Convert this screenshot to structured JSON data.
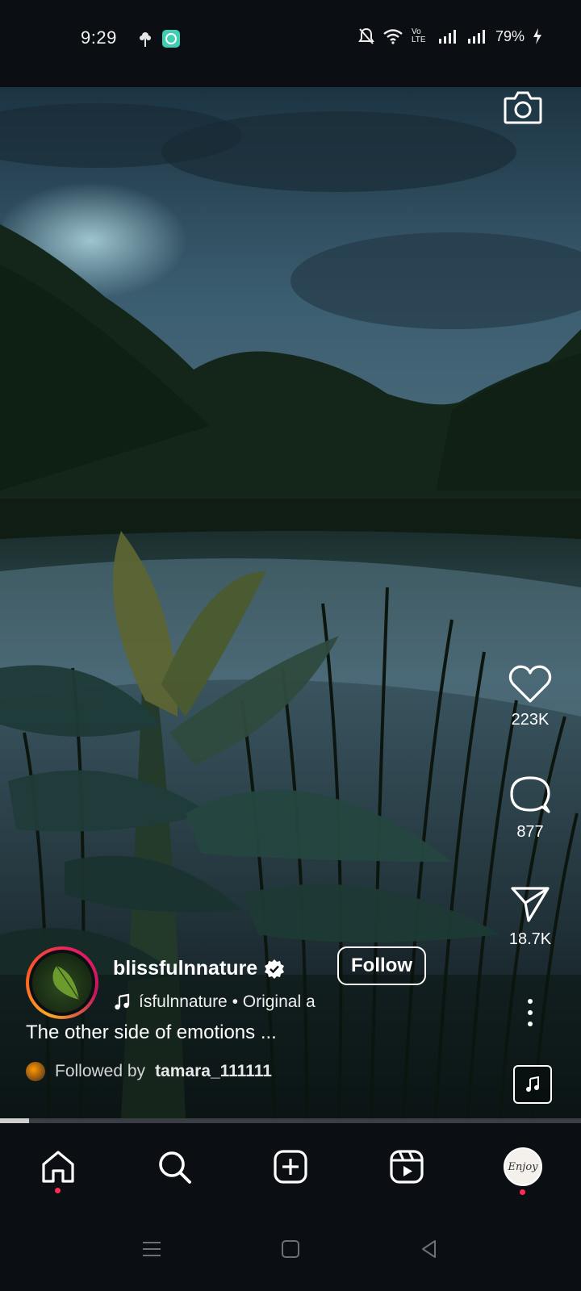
{
  "status_bar": {
    "time": "9:29",
    "battery": "79%",
    "icons": [
      "flower-icon",
      "chat-app-icon",
      "mute-icon",
      "wifi-icon",
      "volte-icon",
      "signal-icon",
      "signal-icon-2",
      "charging-icon"
    ],
    "volte_label": "Vo LTE"
  },
  "reel": {
    "likes": "223K",
    "comments": "877",
    "shares": "18.7K",
    "author": {
      "username": "blissfulnnature",
      "verified": true,
      "audio_text": "ísfulnnature • Original a"
    },
    "follow_label": "Follow",
    "caption": "The other side of emotions ...",
    "followed_by_prefix": "Followed by",
    "followed_by_user": "tamara_111111",
    "progress": 0.05
  },
  "nav": {
    "items": [
      "home-icon",
      "search-icon",
      "create-icon",
      "reels-icon",
      "profile-avatar"
    ],
    "profile_text": "Enjoy"
  },
  "colors": {
    "background": "#0b0f14",
    "notification_dot": "#ff2d55",
    "progress": "#cfcfcf"
  }
}
